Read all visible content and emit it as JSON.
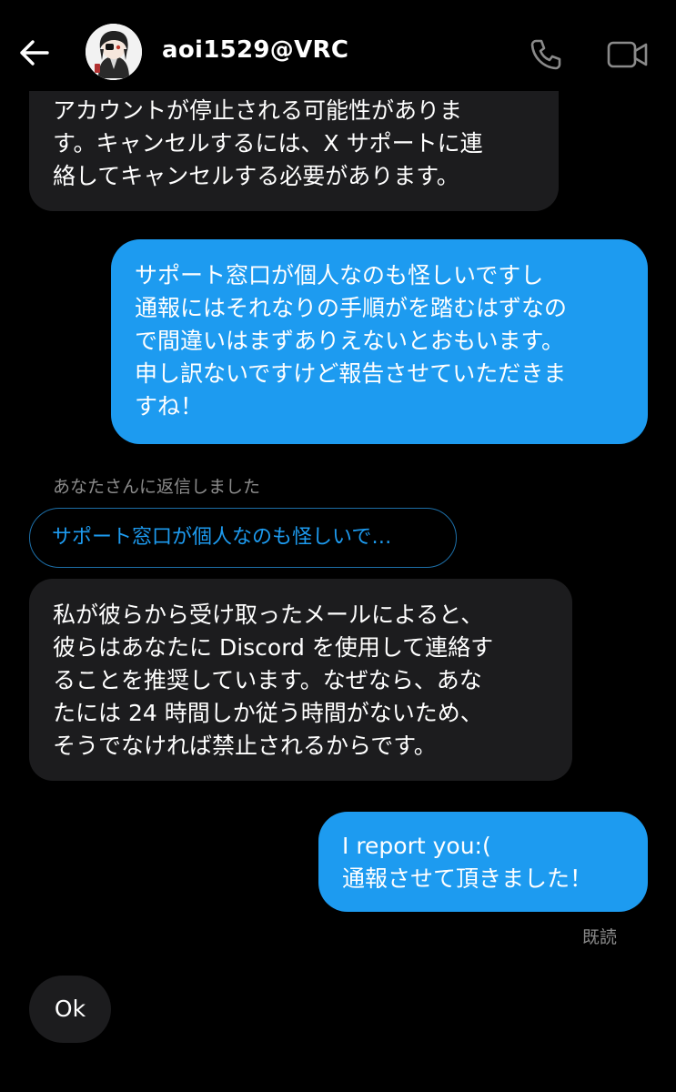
{
  "header": {
    "username": "aoi1529@VRC"
  },
  "messages": {
    "received_partial": {
      "lines": [
        "アカウントが停止される可能性がありま",
        "す。キャンセルするには、X サポートに連",
        "絡してキャンセルする必要があります。"
      ]
    },
    "sent_1": {
      "lines": [
        "サポート窓口が個人なのも怪しいですし",
        "通報にはそれなりの手順がを踏むはずなの",
        "で間違いはまずありえないとおもいます。",
        "申し訳ないですけど報告させていただきま",
        "すね！"
      ]
    },
    "reply_note": "あなたさんに返信しました",
    "reply_quote": "サポート窓口が個人なのも怪しいで…",
    "received_2": {
      "lines": [
        "私が彼らから受け取ったメールによると、",
        "彼らはあなたに Discord を使用して連絡す",
        "ることを推奨しています。なぜなら、あな",
        "たには 24 時間しか従う時間がないため、",
        "そうでなければ禁止されるからです。"
      ]
    },
    "sent_2": {
      "lines": [
        "I report you:(",
        "通報させて頂きました！"
      ]
    },
    "read_status": "既読",
    "received_3": {
      "text": "Ok"
    }
  },
  "colors": {
    "background": "#000000",
    "sent_bubble": "#1d9bf0",
    "received_bubble": "#1c1c1e",
    "muted_text": "#8b8b8b"
  },
  "icons": {
    "back": "arrow-left-icon",
    "phone": "phone-icon",
    "video": "video-camera-icon"
  }
}
